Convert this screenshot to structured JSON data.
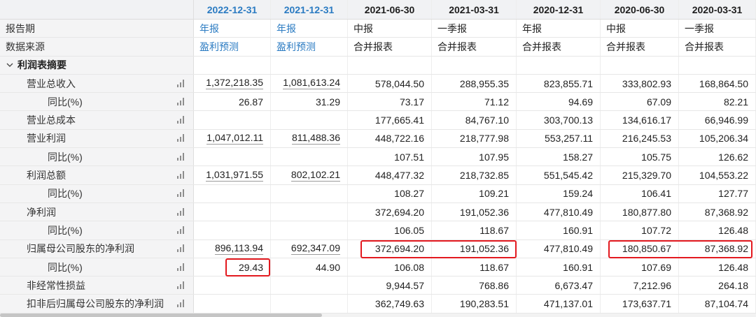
{
  "colors": {
    "link": "#2b7bc2",
    "highlight": "#e3191f"
  },
  "icons": {
    "section_toggle": "chevron-down-icon",
    "row_chart": "bar-chart-icon"
  },
  "header": {
    "dates": [
      "2022-12-31",
      "2021-12-31",
      "2021-06-30",
      "2021-03-31",
      "2020-12-31",
      "2020-06-30",
      "2020-03-31"
    ]
  },
  "period": {
    "label": "报告期",
    "values": [
      "年报",
      "年报",
      "中报",
      "一季报",
      "年报",
      "中报",
      "一季报"
    ]
  },
  "source": {
    "label": "数据来源",
    "values": [
      "盈利预测",
      "盈利预测",
      "合并报表",
      "合并报表",
      "合并报表",
      "合并报表",
      "合并报表"
    ]
  },
  "section": {
    "label": "利润表摘要",
    "expanded": true
  },
  "rows": [
    {
      "label": "营业总收入",
      "values": [
        "1,372,218.35",
        "1,081,613.24",
        "578,044.50",
        "288,955.35",
        "823,855.71",
        "333,802.93",
        "168,864.50"
      ]
    },
    {
      "label": "同比(%)",
      "sub": true,
      "values": [
        "26.87",
        "31.29",
        "73.17",
        "71.12",
        "94.69",
        "67.09",
        "82.21"
      ]
    },
    {
      "label": "营业总成本",
      "values": [
        "",
        "",
        "177,665.41",
        "84,767.10",
        "303,700.13",
        "134,616.17",
        "66,946.99"
      ]
    },
    {
      "label": "营业利润",
      "values": [
        "1,047,012.11",
        "811,488.36",
        "448,722.16",
        "218,777.98",
        "553,257.11",
        "216,245.53",
        "105,206.34"
      ]
    },
    {
      "label": "同比(%)",
      "sub": true,
      "values": [
        "",
        "",
        "107.51",
        "107.95",
        "158.27",
        "105.75",
        "126.62"
      ]
    },
    {
      "label": "利润总额",
      "values": [
        "1,031,971.55",
        "802,102.21",
        "448,477.32",
        "218,732.85",
        "551,545.42",
        "215,329.70",
        "104,553.22"
      ]
    },
    {
      "label": "同比(%)",
      "sub": true,
      "values": [
        "",
        "",
        "108.27",
        "109.21",
        "159.24",
        "106.41",
        "127.77"
      ]
    },
    {
      "label": "净利润",
      "values": [
        "",
        "",
        "372,694.20",
        "191,052.36",
        "477,810.49",
        "180,877.80",
        "87,368.92"
      ]
    },
    {
      "label": "同比(%)",
      "sub": true,
      "values": [
        "",
        "",
        "106.05",
        "118.67",
        "160.91",
        "107.72",
        "126.48"
      ]
    },
    {
      "label": "归属母公司股东的净利润",
      "values": [
        "896,113.94",
        "692,347.09",
        "372,694.20",
        "191,052.36",
        "477,810.49",
        "180,850.67",
        "87,368.92"
      ]
    },
    {
      "label": "同比(%)",
      "sub": true,
      "values": [
        "29.43",
        "44.90",
        "106.08",
        "118.67",
        "160.91",
        "107.69",
        "126.48"
      ]
    },
    {
      "label": "非经常性损益",
      "values": [
        "",
        "",
        "9,944.57",
        "768.86",
        "6,673.47",
        "7,212.96",
        "264.18"
      ]
    },
    {
      "label": "扣非后归属母公司股东的净利润",
      "values": [
        "",
        "",
        "362,749.63",
        "190,283.51",
        "471,137.01",
        "173,637.71",
        "87,104.74"
      ]
    }
  ]
}
